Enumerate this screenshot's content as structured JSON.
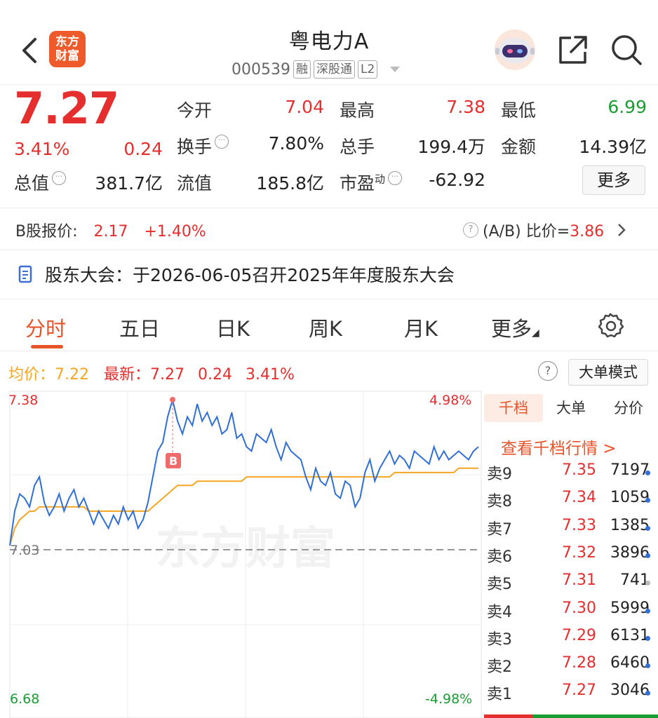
{
  "header": {
    "back_icon": "chevron-left-icon",
    "logo_line1": "东方",
    "logo_line2": "财富",
    "stock_name": "粤电力A",
    "stock_code": "000539",
    "tags": [
      "融",
      "深股通",
      "L2"
    ],
    "colors": {
      "brand": "#ef5a2a",
      "up": "#e52e2e",
      "down": "#1a9e32",
      "accent": "#e8542a",
      "line": "#2f6fd6",
      "avg": "#f5a623"
    }
  },
  "quote": {
    "price": "7.27",
    "change_pct": "3.41%",
    "change": "0.24",
    "open_label": "今开",
    "open": "7.04",
    "high_label": "最高",
    "high": "7.38",
    "low_label": "最低",
    "low": "6.99",
    "turnover_label": "换手",
    "turnover": "7.80%",
    "volume_label": "总手",
    "volume": "199.4万",
    "amount_label": "金额",
    "amount": "14.39亿",
    "mktcap_label": "总值",
    "mktcap": "381.7亿",
    "float_label": "流值",
    "float": "185.8亿",
    "pe_label": "市盈",
    "pe_sup": "动",
    "pe": "-62.92",
    "more_button": "更多"
  },
  "b_share": {
    "label": "B股报价:",
    "price": "2.17",
    "change": "+1.40%",
    "ratio_label": "(A/B) 比价=",
    "ratio": "3.86"
  },
  "meeting": {
    "text": "股东大会：于2026-06-05召开2025年年度股东大会"
  },
  "tabs": [
    "分时",
    "五日",
    "日K",
    "周K",
    "月K",
    "更多"
  ],
  "active_tab": 0,
  "avg_row": {
    "avg_label": "均价：",
    "avg": "7.22",
    "latest_label": "最新：",
    "latest": "7.27",
    "change": "0.24",
    "pct": "3.41%"
  },
  "big_order_mode": "大单模式",
  "chart_data": {
    "type": "line",
    "title": "",
    "ylim": [
      6.68,
      7.38
    ],
    "y_labels": {
      "top": "7.38",
      "mid": "7.03",
      "bottom": "6.68"
    },
    "pct_labels": {
      "top": "4.98%",
      "bottom": "-4.98%"
    },
    "prev_close": 7.03,
    "watermark": "东方财富",
    "buy_marker": "B",
    "series": [
      {
        "values": [
          7.04,
          7.12,
          7.16,
          7.15,
          7.13,
          7.18,
          7.2,
          7.14,
          7.11,
          7.13,
          7.16,
          7.12,
          7.15,
          7.17,
          7.13,
          7.15,
          7.12,
          7.09,
          7.12,
          7.1,
          7.08,
          7.11,
          7.09,
          7.13,
          7.1,
          7.12,
          7.08,
          7.1,
          7.14,
          7.2,
          7.26,
          7.28,
          7.34,
          7.38,
          7.33,
          7.3,
          7.34,
          7.32,
          7.37,
          7.33,
          7.35,
          7.32,
          7.34,
          7.3,
          7.31,
          7.35,
          7.29,
          7.3,
          7.27,
          7.26,
          7.3,
          7.29,
          7.28,
          7.31,
          7.27,
          7.24,
          7.28,
          7.26,
          7.25,
          7.24,
          7.2,
          7.17,
          7.22,
          7.19,
          7.18,
          7.21,
          7.16,
          7.15,
          7.19,
          7.18,
          7.13,
          7.15,
          7.21,
          7.24,
          7.19,
          7.22,
          7.24,
          7.26,
          7.23,
          7.25,
          7.24,
          7.22,
          7.26,
          7.25,
          7.24,
          7.23,
          7.27,
          7.24,
          7.26,
          7.24,
          7.25,
          7.26,
          7.25,
          7.24,
          7.26,
          7.27
        ],
        "color": "#2f6fd6"
      },
      {
        "values": [
          7.04,
          7.08,
          7.1,
          7.11,
          7.12,
          7.12,
          7.13,
          7.13,
          7.13,
          7.13,
          7.13,
          7.13,
          7.13,
          7.13,
          7.13,
          7.13,
          7.12,
          7.12,
          7.12,
          7.12,
          7.12,
          7.12,
          7.12,
          7.12,
          7.12,
          7.12,
          7.12,
          7.12,
          7.12,
          7.13,
          7.14,
          7.15,
          7.16,
          7.17,
          7.18,
          7.18,
          7.18,
          7.18,
          7.19,
          7.19,
          7.19,
          7.19,
          7.19,
          7.19,
          7.19,
          7.19,
          7.19,
          7.19,
          7.2,
          7.2,
          7.2,
          7.2,
          7.2,
          7.2,
          7.2,
          7.2,
          7.2,
          7.2,
          7.2,
          7.2,
          7.2,
          7.2,
          7.2,
          7.2,
          7.2,
          7.2,
          7.2,
          7.2,
          7.2,
          7.2,
          7.2,
          7.2,
          7.2,
          7.2,
          7.2,
          7.2,
          7.2,
          7.2,
          7.21,
          7.21,
          7.21,
          7.21,
          7.21,
          7.21,
          7.21,
          7.21,
          7.21,
          7.21,
          7.21,
          7.21,
          7.21,
          7.22,
          7.22,
          7.22,
          7.22,
          7.22
        ],
        "color": "#f5a623"
      }
    ]
  },
  "order_book": {
    "tabs": [
      "千档",
      "大单",
      "分价"
    ],
    "view_link": "查看千档行情 >",
    "rows": [
      {
        "label": "卖9",
        "price": "7.35",
        "vol": "7197",
        "dot": "blue"
      },
      {
        "label": "卖8",
        "price": "7.34",
        "vol": "1059",
        "dot": "blue"
      },
      {
        "label": "卖7",
        "price": "7.33",
        "vol": "1385",
        "dot": "blue"
      },
      {
        "label": "卖6",
        "price": "7.32",
        "vol": "3896",
        "dot": "blue"
      },
      {
        "label": "卖5",
        "price": "7.31",
        "vol": "741",
        "dot": "gray"
      },
      {
        "label": "卖4",
        "price": "7.30",
        "vol": "5999",
        "dot": "blue"
      },
      {
        "label": "卖3",
        "price": "7.29",
        "vol": "6131",
        "dot": "blue"
      },
      {
        "label": "卖2",
        "price": "7.28",
        "vol": "6460",
        "dot": "blue"
      },
      {
        "label": "卖1",
        "price": "7.27",
        "vol": "3046",
        "dot": "blue"
      }
    ]
  }
}
